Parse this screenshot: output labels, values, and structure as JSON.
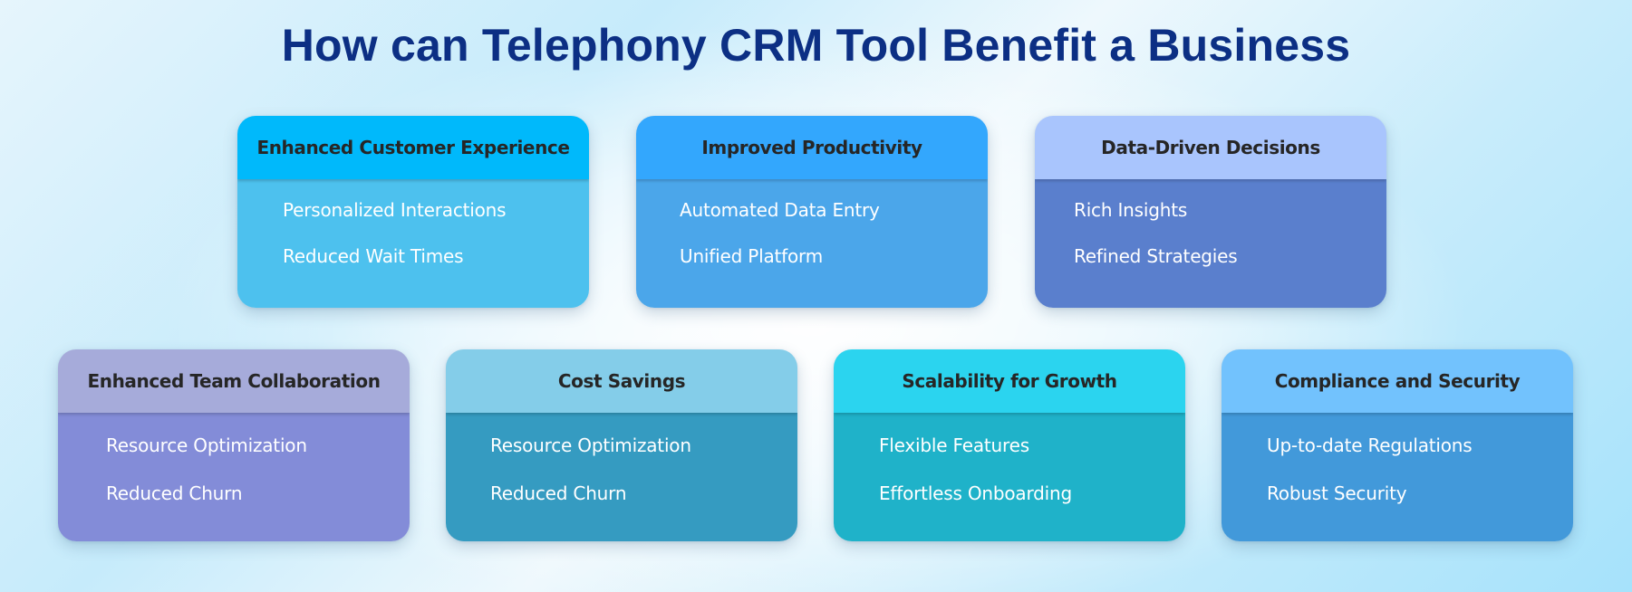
{
  "title": "How can Telephony CRM Tool Benefit a Business",
  "cards": [
    {
      "title": "Enhanced Customer Experience",
      "items": [
        "Personalized Interactions",
        "Reduced Wait Times"
      ],
      "header_color": "#00b9fb",
      "body_color": "#4dc1ee"
    },
    {
      "title": "Improved Productivity",
      "items": [
        "Automated Data Entry",
        "Unified Platform"
      ],
      "header_color": "#33a7fd",
      "body_color": "#4ba6ea"
    },
    {
      "title": "Data-Driven Decisions",
      "items": [
        "Rich Insights",
        "Refined Strategies"
      ],
      "header_color": "#a9c5fd",
      "body_color": "#5a7fcd"
    },
    {
      "title": "Enhanced Team Collaboration",
      "items": [
        "Resource Optimization",
        "Reduced Churn"
      ],
      "header_color": "#a6abda",
      "body_color": "#838cd8"
    },
    {
      "title": "Cost Savings",
      "items": [
        "Resource Optimization",
        "Reduced Churn"
      ],
      "header_color": "#84cde9",
      "body_color": "#359bc1"
    },
    {
      "title": "Scalability for Growth",
      "items": [
        "Flexible Features",
        "Effortless Onboarding"
      ],
      "header_color": "#2bd4ef",
      "body_color": "#1fb2c9"
    },
    {
      "title": "Compliance and Security",
      "items": [
        "Up-to-date Regulations",
        "Robust Security"
      ],
      "header_color": "#72c2fd",
      "body_color": "#4299da"
    }
  ]
}
